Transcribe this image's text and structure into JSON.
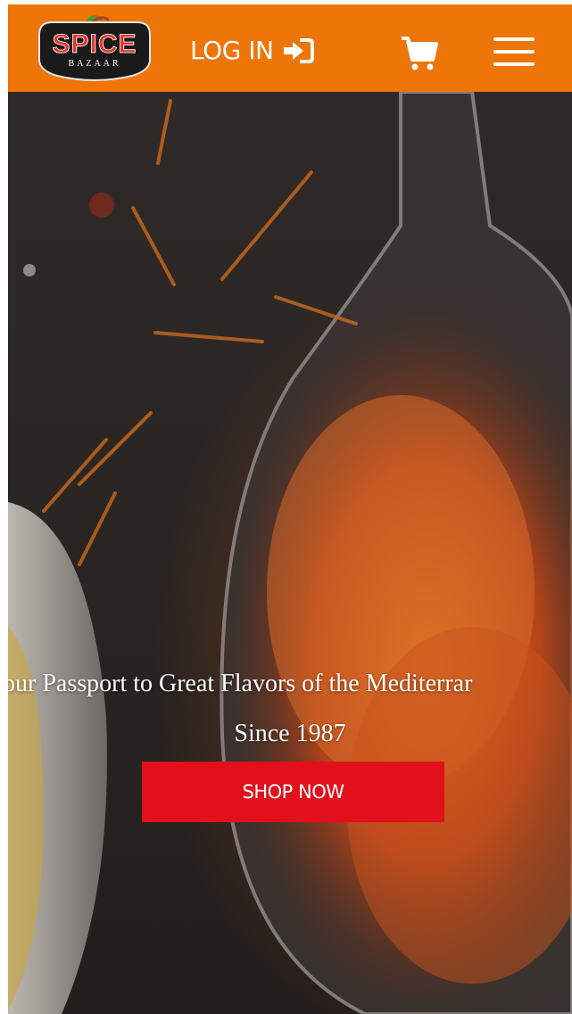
{
  "header": {
    "logo_word": "SPICE",
    "logo_sub": "BAZAAR",
    "login_label": "LOG IN",
    "icons": {
      "login": "sign-in-icon",
      "cart": "shopping-cart-icon",
      "menu": "hamburger-menu-icon"
    },
    "colors": {
      "bar": "#ee7508",
      "logo_bg": "#1a1a1a"
    }
  },
  "hero": {
    "tagline": "our Passport to Great Flavors of the Mediterrar",
    "since": "Since 1987",
    "cta_label": "SHOP NOW",
    "colors": {
      "cta": "#e1101a",
      "text": "#ffffff"
    }
  }
}
